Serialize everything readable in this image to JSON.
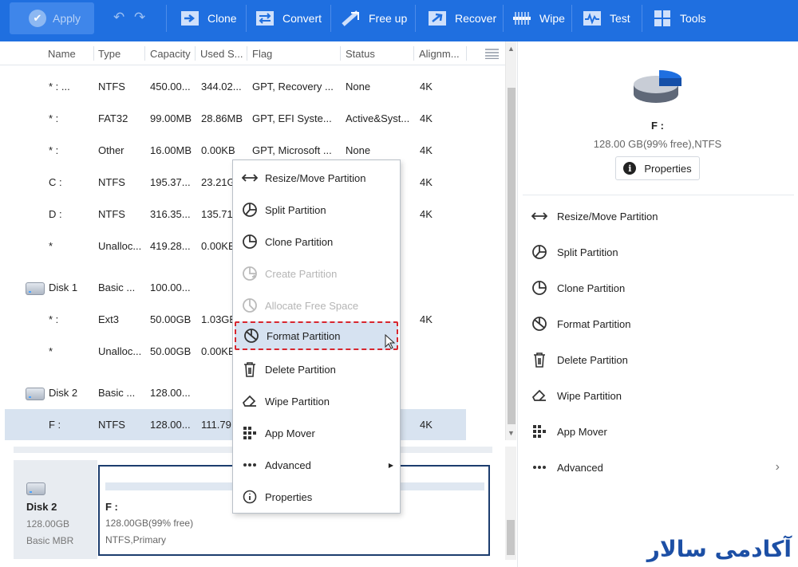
{
  "toolbar": {
    "apply": "Apply",
    "items": [
      "Clone",
      "Convert",
      "Free up",
      "Recover",
      "Wipe",
      "Test",
      "Tools"
    ]
  },
  "columns": [
    "Name",
    "Type",
    "Capacity",
    "Used S...",
    "Flag",
    "Status",
    "Alignm..."
  ],
  "rows": [
    {
      "name": "* : ...",
      "type": "NTFS",
      "capacity": "450.00...",
      "used": "344.02...",
      "flag": "GPT, Recovery ...",
      "status": "None",
      "align": "4K"
    },
    {
      "name": "* :",
      "type": "FAT32",
      "capacity": "99.00MB",
      "used": "28.86MB",
      "flag": "GPT, EFI Syste...",
      "status": "Active&Syst...",
      "align": "4K"
    },
    {
      "name": "* :",
      "type": "Other",
      "capacity": "16.00MB",
      "used": "0.00KB",
      "flag": "GPT, Microsoft ...",
      "status": "None",
      "align": "4K"
    },
    {
      "name": "C :",
      "type": "NTFS",
      "capacity": "195.37...",
      "used": "23.21G",
      "flag": "",
      "status": "",
      "align": "4K"
    },
    {
      "name": "D :",
      "type": "NTFS",
      "capacity": "316.35...",
      "used": "135.71",
      "flag": "",
      "status": "",
      "align": "4K"
    },
    {
      "name": "*",
      "type": "Unalloc...",
      "capacity": "419.28...",
      "used": "0.00KB",
      "flag": "",
      "status": "",
      "align": ""
    },
    {
      "name": "Disk 1",
      "type": "Basic ...",
      "capacity": "100.00...",
      "used": "",
      "flag": "",
      "status": "",
      "align": ""
    },
    {
      "name": "* :",
      "type": "Ext3",
      "capacity": "50.00GB",
      "used": "1.03GB",
      "flag": "",
      "status": "",
      "align": "4K"
    },
    {
      "name": "*",
      "type": "Unalloc...",
      "capacity": "50.00GB",
      "used": "0.00KB",
      "flag": "",
      "status": "",
      "align": ""
    },
    {
      "name": "Disk 2",
      "type": "Basic ...",
      "capacity": "128.00...",
      "used": "",
      "flag": "",
      "status": "",
      "align": ""
    },
    {
      "name": "F :",
      "type": "NTFS",
      "capacity": "128.00...",
      "used": "111.79",
      "flag": "",
      "status": "",
      "align": "4K"
    }
  ],
  "diskmap": {
    "disk_name": "Disk 2",
    "disk_size": "128.00GB",
    "disk_type": "Basic MBR",
    "part_name": "F :",
    "part_size": "128.00GB(99% free)",
    "part_fs": "NTFS,Primary"
  },
  "context_menu": [
    {
      "label": "Resize/Move Partition",
      "icon": "resize-icon",
      "disabled": false
    },
    {
      "label": "Split Partition",
      "icon": "split-icon",
      "disabled": false
    },
    {
      "label": "Clone Partition",
      "icon": "clone-icon",
      "disabled": false
    },
    {
      "label": "Create Partition",
      "icon": "create-icon",
      "disabled": true
    },
    {
      "label": "Allocate Free Space",
      "icon": "allocate-icon",
      "disabled": true
    },
    {
      "label": "Format Partition",
      "icon": "format-icon",
      "disabled": false,
      "highlighted": true
    },
    {
      "label": "Delete Partition",
      "icon": "trash-icon",
      "disabled": false
    },
    {
      "label": "Wipe Partition",
      "icon": "eraser-icon",
      "disabled": false
    },
    {
      "label": "App Mover",
      "icon": "app-mover-icon",
      "disabled": false
    },
    {
      "label": "Advanced",
      "icon": "more-icon",
      "disabled": false
    },
    {
      "label": "Properties",
      "icon": "info-icon",
      "disabled": false
    }
  ],
  "right_panel": {
    "name": "F :",
    "info": "128.00 GB(99% free),NTFS",
    "properties_btn": "Properties",
    "items": [
      "Resize/Move Partition",
      "Split Partition",
      "Clone Partition",
      "Format Partition",
      "Delete Partition",
      "Wipe Partition",
      "App Mover",
      "Advanced"
    ]
  },
  "watermark": "آکادمی سالار",
  "colors": {
    "toolbar": "#1f6fe0",
    "highlight_border": "#d7262e",
    "selection": "#d8e3f0"
  }
}
